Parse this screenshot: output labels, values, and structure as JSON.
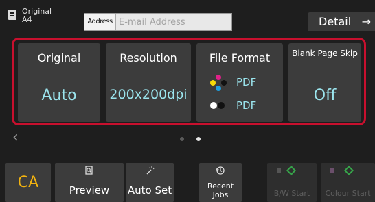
{
  "original_indicator": {
    "line1": "Original",
    "line2": "A4",
    "icon": "document-icon"
  },
  "address": {
    "label": "Address",
    "placeholder": "E-mail Address",
    "value": ""
  },
  "detail": {
    "label": "Detail",
    "arrow": "→"
  },
  "tiles": [
    {
      "title": "Original",
      "value": "Auto"
    },
    {
      "title": "Resolution",
      "value": "200x200dpi"
    },
    {
      "title": "File Format",
      "color_value": "PDF",
      "bw_value": "PDF"
    },
    {
      "title": "Blank Page Skip",
      "value": "Off"
    }
  ],
  "pager": {
    "prev_arrow": "‹",
    "pages": 2,
    "current_page": 2
  },
  "bottom": {
    "ca_label": "CA",
    "preview_label": "Preview",
    "autoset_label": "Auto Set",
    "recent_label": "Recent Jobs",
    "bw_start_label": "B/W Start",
    "color_start_label": "Colour Start"
  },
  "colors": {
    "highlight": "#c8102e",
    "value_text": "#9be5ee",
    "ca_text": "#f2b20f",
    "start_diamond": "#37a44a"
  }
}
